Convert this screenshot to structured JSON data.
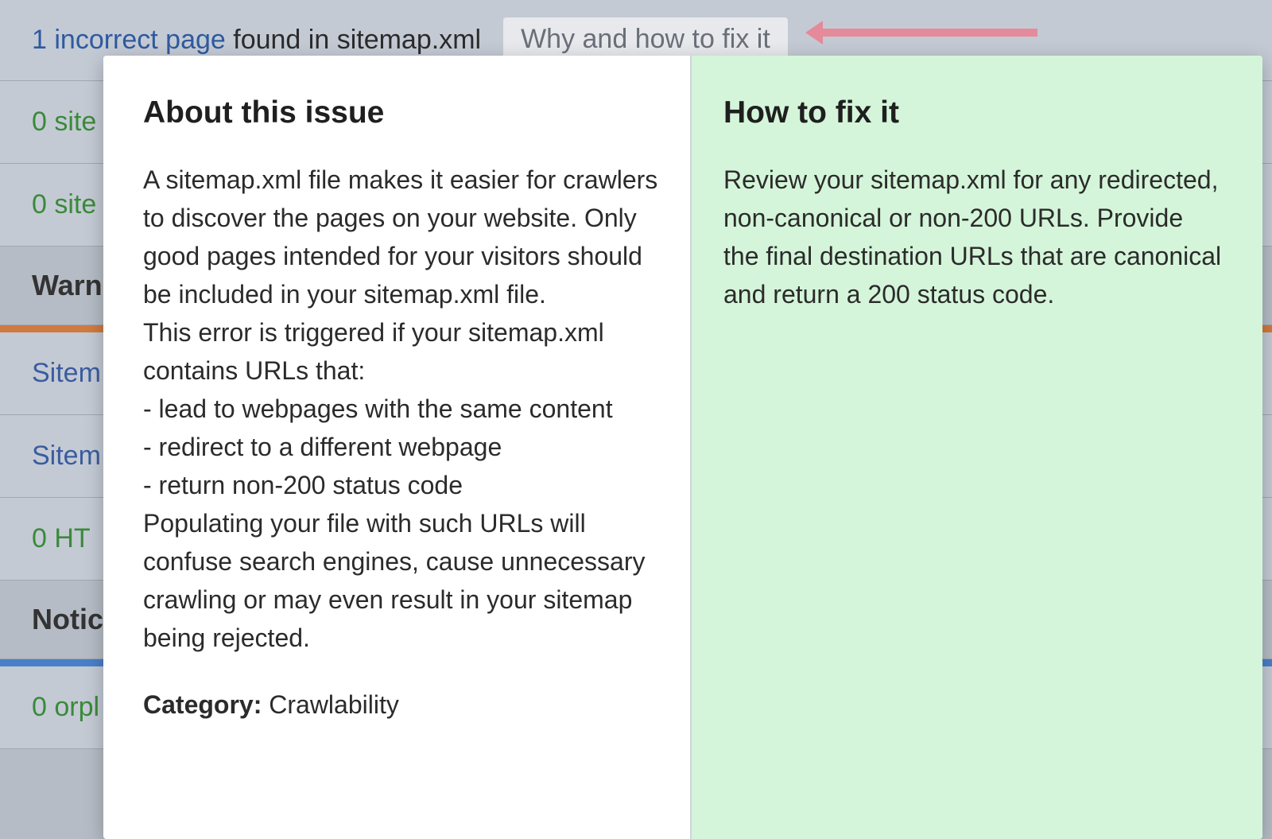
{
  "header": {
    "issue_link_text": "1 incorrect page",
    "issue_suffix": " found in sitemap.xml",
    "tooltip_trigger": "Why and how to fix it"
  },
  "background_rows": [
    {
      "type": "item",
      "text": "0 site"
    },
    {
      "type": "item",
      "text": "0 site"
    },
    {
      "type": "section",
      "text": "Warn",
      "accent": "orange"
    },
    {
      "type": "item_link",
      "text": "Sitem"
    },
    {
      "type": "item_link",
      "text": "Sitem"
    },
    {
      "type": "item",
      "text": "0 HT"
    },
    {
      "type": "section",
      "text": "Notic",
      "accent": "blue"
    },
    {
      "type": "item",
      "text": "0 orpl"
    }
  ],
  "popup": {
    "about": {
      "title": "About this issue",
      "body": "A sitemap.xml file makes it easier for crawlers to discover the pages on your website. Only good pages intended for your visitors should be included in your sitemap.xml file.\nThis error is triggered if your sitemap.xml contains URLs that:\n- lead to webpages with the same content\n- redirect to a different webpage\n- return non-200 status code\nPopulating your file with such URLs will confuse search engines, cause unnecessary crawling or may even result in your sitemap being rejected.",
      "category_label": "Category: ",
      "category_value": "Crawlability"
    },
    "fix": {
      "title": "How to fix it",
      "body": "Review your sitemap.xml for any redirected, non-canonical or non-200 URLs. Provide the final destination URLs that are canonical and return a 200 status code."
    }
  }
}
